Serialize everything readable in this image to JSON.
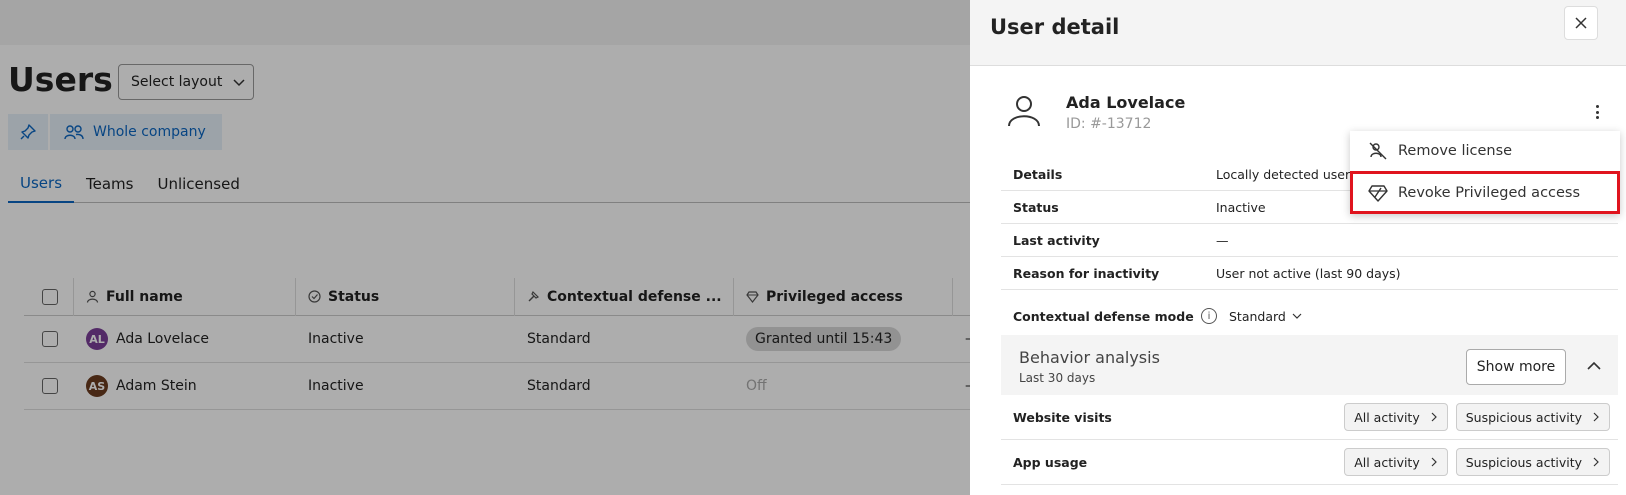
{
  "page": {
    "title": "Users",
    "layout_button": "Select layout",
    "filter_chip": "Whole company",
    "tabs": [
      "Users",
      "Teams",
      "Unlicensed"
    ],
    "table": {
      "headers": [
        "Full name",
        "Status",
        "Contextual defense ...",
        "Privileged access"
      ],
      "rows": [
        {
          "initials": "AL",
          "name": "Ada Lovelace",
          "status": "Inactive",
          "mode": "Standard",
          "privileged": "Granted until 15:43",
          "extra": "—",
          "avatar_color": "#7b3f98"
        },
        {
          "initials": "AS",
          "name": "Adam Stein",
          "status": "Inactive",
          "mode": "Standard",
          "privileged": "Off",
          "extra": "—",
          "avatar_color": "#6b3c1f"
        }
      ]
    }
  },
  "panel": {
    "title": "User detail",
    "user_name": "Ada Lovelace",
    "user_id": "ID: #-13712",
    "details": [
      {
        "key": "Details",
        "value": "Locally detected user"
      },
      {
        "key": "Status",
        "value": "Inactive"
      },
      {
        "key": "Last activity",
        "value": "—"
      },
      {
        "key": "Reason for inactivity",
        "value": "User not active (last 90 days)"
      }
    ],
    "contextual_mode": {
      "key": "Contextual defense mode",
      "value": "Standard"
    },
    "behavior": {
      "title": "Behavior analysis",
      "subtitle": "Last 30 days",
      "show_more": "Show more"
    },
    "activity_rows": [
      {
        "key": "Website visits",
        "all": "All activity",
        "suspicious": "Suspicious activity"
      },
      {
        "key": "App usage",
        "all": "All activity",
        "suspicious": "Suspicious activity"
      }
    ]
  },
  "menu": {
    "items": [
      "Remove license",
      "Revoke Privileged access"
    ]
  },
  "colors": {
    "accent": "#0b66c2",
    "highlight": "#e0141e"
  }
}
